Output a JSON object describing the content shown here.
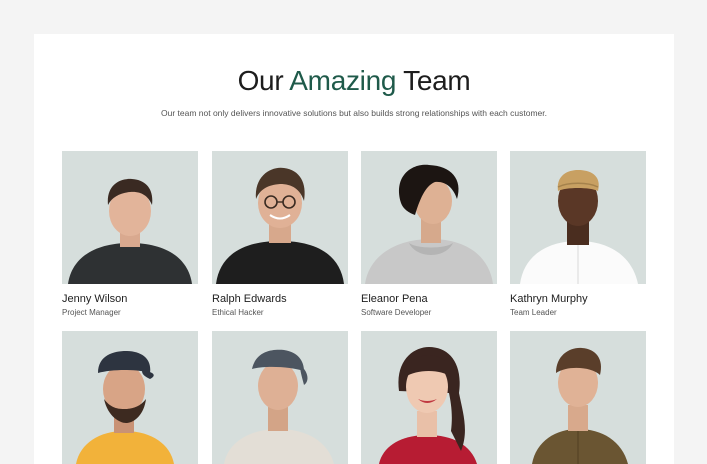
{
  "header": {
    "title_prefix": "Our",
    "title_accent": "Amazing",
    "title_suffix": "Team",
    "subtitle": "Our team not only delivers innovative solutions but also builds strong relationships with each customer."
  },
  "members": [
    {
      "name": "Jenny Wilson",
      "role": "Project Manager"
    },
    {
      "name": "Ralph Edwards",
      "role": "Ethical Hacker"
    },
    {
      "name": "Eleanor Pena",
      "role": "Software Developer"
    },
    {
      "name": "Kathryn Murphy",
      "role": "Team Leader"
    },
    {
      "name": "",
      "role": ""
    },
    {
      "name": "",
      "role": ""
    },
    {
      "name": "",
      "role": ""
    },
    {
      "name": "",
      "role": ""
    }
  ],
  "colors": {
    "accent": "#1f5a4a",
    "photo_bg": "#d6dedc",
    "page_bg": "#f4f4f4"
  }
}
